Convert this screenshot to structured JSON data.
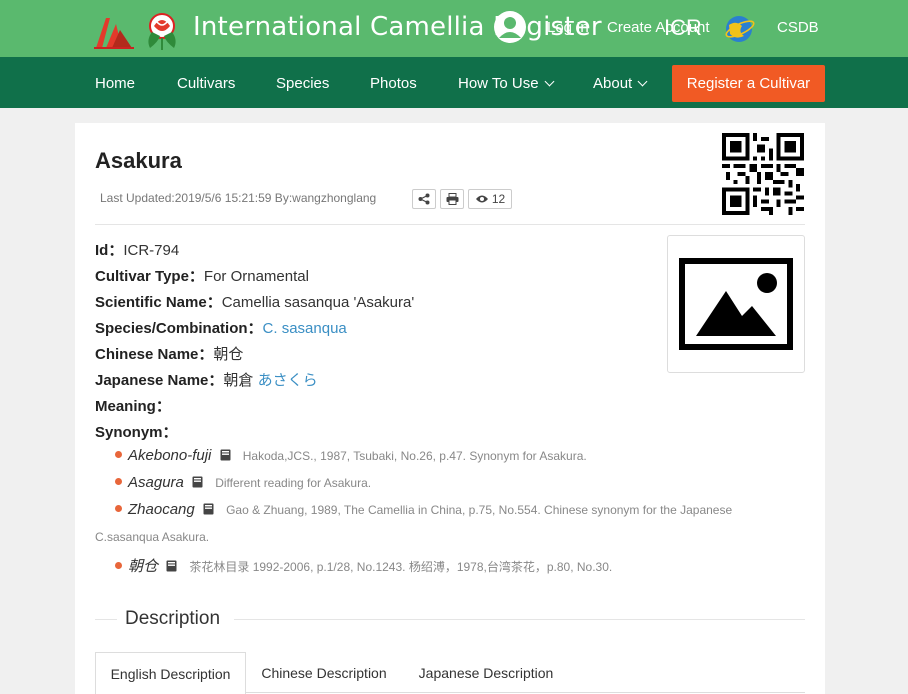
{
  "header": {
    "site_title": "International Camellia Register",
    "login": "Log In",
    "create_account": "Create Account",
    "icr": "ICR",
    "csdb": "CSDB"
  },
  "nav": {
    "home": "Home",
    "cultivars": "Cultivars",
    "species": "Species",
    "photos": "Photos",
    "how_to_use": "How To Use",
    "about": "About",
    "register": "Register a Cultivar"
  },
  "record": {
    "title": "Asakura",
    "last_updated": "Last Updated:2019/5/6 15:21:59 By:wangzhonglang",
    "view_count": "12",
    "fields": {
      "id_label": "Id：",
      "id_value": "ICR-794",
      "type_label": "Cultivar Type：",
      "type_value": "For Ornamental",
      "sci_label": "Scientific Name：",
      "sci_value": "Camellia sasanqua 'Asakura'",
      "species_label": "Species/Combination：",
      "species_value": "C. sasanqua",
      "chinese_label": "Chinese Name：",
      "chinese_value": "朝仓",
      "japanese_label": "Japanese Name：",
      "japanese_value": "朝倉",
      "japanese_kana": "あさくら",
      "meaning_label": "Meaning：",
      "synonym_label": "Synonym："
    },
    "synonyms": [
      {
        "name": "Akebono-fuji",
        "ref": "Hakoda,JCS., 1987, Tsubaki, No.26, p.47. Synonym for Asakura."
      },
      {
        "name": "Asagura",
        "ref": "Different reading for Asakura."
      },
      {
        "name": "Zhaocang",
        "ref": "Gao & Zhuang, 1989, The Camellia in China, p.75, No.554. Chinese synonym for the Japanese",
        "ref_cont": "C.sasanqua Asakura."
      },
      {
        "name": "朝仓",
        "ref": "茶花林目录 1992-2006, p.1/28, No.1243. 杨绍溥，1978,台湾茶花，p.80, No.30."
      }
    ]
  },
  "description": {
    "title": "Description",
    "tabs": [
      "English Description",
      "Chinese Description",
      "Japanese Description"
    ]
  },
  "colors": {
    "topbar": "#5ab96e",
    "navbar": "#10704a",
    "accent": "#f15a24",
    "link": "#3b8fc4"
  }
}
